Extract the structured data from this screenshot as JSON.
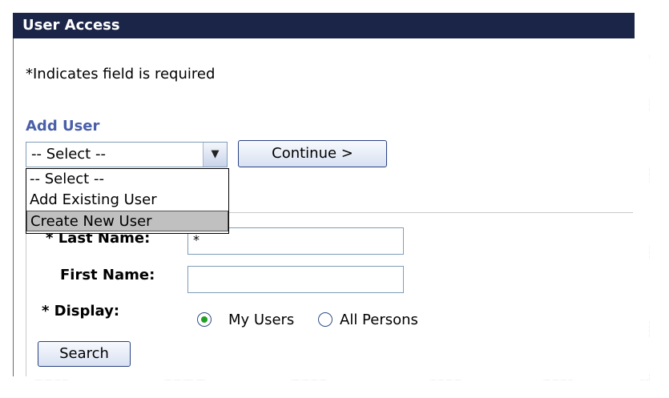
{
  "panel": {
    "title": "User Access"
  },
  "required_note": "*Indicates field is required",
  "add_user": {
    "label": "Add User",
    "selected": "-- Select --",
    "options": [
      "-- Select --",
      "Add Existing User",
      "Create New User"
    ],
    "highlighted_option": "Create New User",
    "continue_label": "Continue >"
  },
  "search": {
    "last_name_label": "Last Name:",
    "last_name_value": "*",
    "first_name_label": "First Name:",
    "first_name_value": "",
    "display_label": "* Display:",
    "display_options": [
      "My Users",
      "All Persons"
    ],
    "display_selected": "My Users",
    "search_label": "Search"
  },
  "colors": {
    "titlebar": "#1b2548",
    "add_user_label": "#4a5fa8",
    "radio_selected": "#21a121"
  }
}
